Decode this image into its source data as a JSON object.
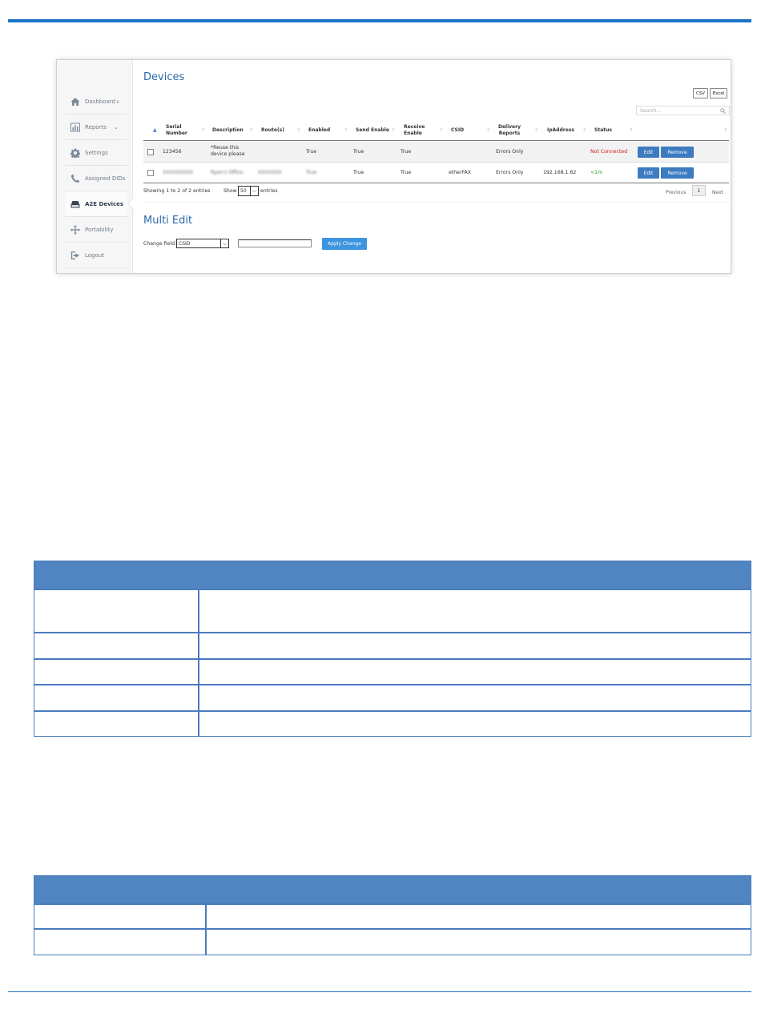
{
  "sidebar": {
    "items": [
      {
        "label": "Dashboard",
        "icon": "home-icon",
        "chevron": "»"
      },
      {
        "label": "Reports",
        "icon": "bar-chart-icon",
        "chevron": "⌄"
      },
      {
        "label": "Settings",
        "icon": "gear-icon"
      },
      {
        "label": "Assigned DIDs",
        "icon": "phone-icon"
      },
      {
        "label": "A2E Devices",
        "icon": "hard-drive-icon",
        "active": true
      },
      {
        "label": "Portability",
        "icon": "move-arrows-icon"
      },
      {
        "label": "Logout",
        "icon": "logout-icon"
      }
    ]
  },
  "devices": {
    "title": "Devices",
    "csv_label": "CSV",
    "excel_label": "Excel",
    "search_placeholder": "Search...",
    "columns": [
      "Serial Number",
      "Description",
      "Route(s)",
      "Enabled",
      "Send Enable",
      "Receive Enable",
      "CSID",
      "Delivery Reports",
      "IpAddress",
      "Status"
    ],
    "rows": [
      {
        "serial": "123456",
        "description": "*Reuse this device please",
        "routes": "",
        "enabled": "True",
        "send_enable": "True",
        "receive_enable": "True",
        "csid": "",
        "delivery_reports": "Errors Only",
        "ip_address": "",
        "status": "Not Connected",
        "edit_label": "Edit",
        "remove_label": "Remove"
      },
      {
        "serial": "XXXXXXXXX",
        "description": "Ryan's Office",
        "routes": "XXXXXXX",
        "enabled": "True",
        "send_enable": "True",
        "receive_enable": "True",
        "csid": "etherFAX",
        "delivery_reports": "Errors Only",
        "ip_address": "192.168.1.62",
        "status": "<1m",
        "edit_label": "Edit",
        "remove_label": "Remove"
      }
    ],
    "info": "Showing 1 to 2 of 2 entries",
    "show_label": "Show",
    "page_size": "50",
    "entries_label": "entries",
    "pagination": {
      "previous": "Previous",
      "current": "1",
      "next": "Next"
    }
  },
  "multi_edit": {
    "title": "Multi Edit",
    "change_field_label": "Change field:",
    "field_value": "CSID",
    "input_value": "",
    "apply_label": "Apply Change"
  },
  "colors": {
    "accent": "#2a68a8",
    "button": "#3c7bc0",
    "apply": "#3d94e0",
    "rule": "#1a73c9",
    "table_header": "#5085c1",
    "status_error": "#d01818",
    "status_ok": "#2b9a2b"
  }
}
